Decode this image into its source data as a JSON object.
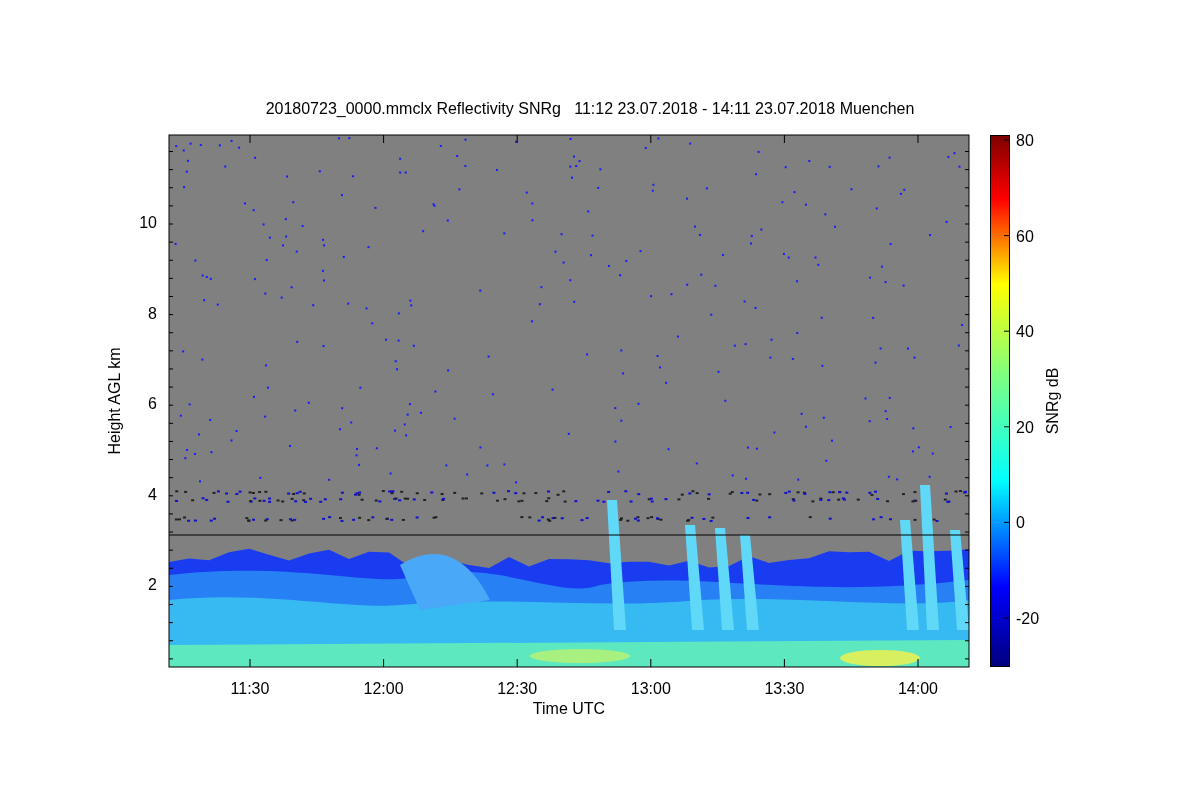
{
  "title": "20180723_0000.mmclx Reflectivity SNRg   11:12 23.07.2018 - 14:11 23.07.2018 Muenchen",
  "y_axis": {
    "label": "Height AGL km",
    "ticks": [
      "10",
      "8",
      "6",
      "4",
      "2"
    ]
  },
  "x_axis": {
    "label": "Time UTC",
    "ticks": [
      "11:30",
      "12:00",
      "12:30",
      "13:00",
      "13:30",
      "14:00"
    ]
  },
  "colorbar": {
    "label": "SNRg dB",
    "ticks": [
      "80",
      "60",
      "40",
      "20",
      "0",
      "-20"
    ]
  }
}
